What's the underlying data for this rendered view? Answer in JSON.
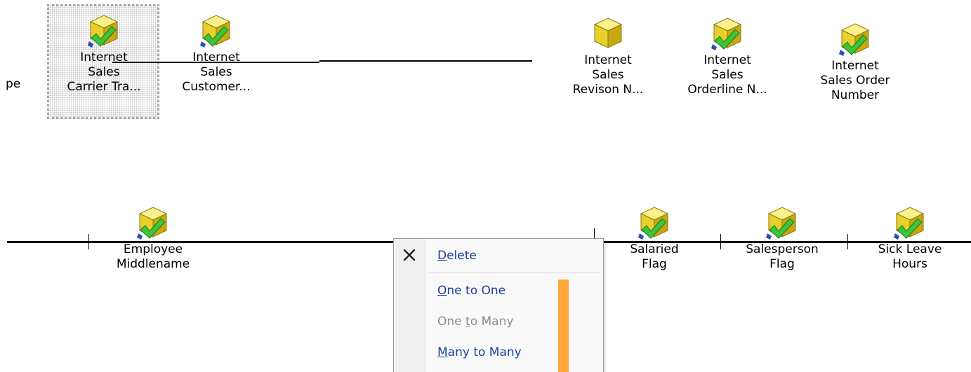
{
  "colors": {
    "accent": "#FFA53A",
    "menu_link": "#1a3e9c",
    "menu_disabled": "#8c8c8c",
    "cube_face": "#f5e150",
    "check": "#3cc43c"
  },
  "cut_text": "pe",
  "top_nodes": [
    {
      "id": "n1",
      "label": "Internet\nSales\nCarrier Tra...",
      "icon": "cube-check-icon",
      "selected": true
    },
    {
      "id": "n2",
      "label": "Internet\nSales\nCustomer...",
      "icon": "cube-check-icon"
    },
    {
      "id": "n3",
      "label": "Internet\nSales\nRevison N...",
      "icon": "cube-icon"
    },
    {
      "id": "n4",
      "label": "Internet\nSales\nOrderline N...",
      "icon": "cube-check-icon"
    },
    {
      "id": "n5",
      "label": "Internet\nSales Order\nNumber",
      "icon": "cube-check-icon"
    }
  ],
  "bottom_nodes": [
    {
      "id": "b1",
      "label": "Employee\nMiddlename",
      "icon": "cube-check-icon"
    },
    {
      "id": "b2",
      "label": "Salaried\nFlag",
      "icon": "cube-check-icon"
    },
    {
      "id": "b3",
      "label": "Salesperson\nFlag",
      "icon": "cube-check-icon"
    },
    {
      "id": "b4",
      "label": "Sick Leave\nHours",
      "icon": "cube-check-icon"
    }
  ],
  "context_menu": {
    "close_icon": "close-x-icon",
    "items": [
      {
        "label": "Delete",
        "mnemonic": "D",
        "enabled": true
      },
      {
        "label": "One to One",
        "mnemonic": "O",
        "enabled": true
      },
      {
        "label": "One to Many",
        "mnemonic": "t",
        "enabled": false
      },
      {
        "label": "Many to Many",
        "mnemonic": "M",
        "enabled": true
      }
    ]
  }
}
